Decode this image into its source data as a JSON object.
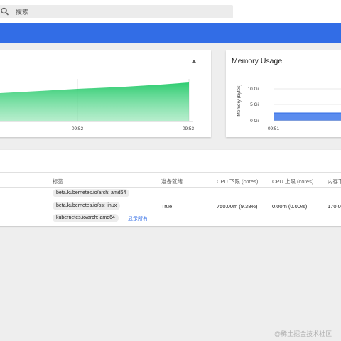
{
  "header": {
    "search": {
      "placeholder": "搜索"
    }
  },
  "colors": {
    "accent": "#326de6",
    "cpu_fill": "#2ecc71",
    "memory_fill": "#326de6"
  },
  "cpu_chart": {
    "x_ticks": [
      "09:52",
      "09:53"
    ]
  },
  "memory_chart": {
    "title": "Memory Usage",
    "y_label": "Memory (bytes)",
    "y_ticks": [
      "10 Gi",
      "5 Gi",
      "0 Gi"
    ],
    "x_ticks": [
      "09:51"
    ]
  },
  "table": {
    "columns": [
      "标签",
      "准备就绪",
      "CPU 下限 (cores)",
      "CPU 上限 (cores)",
      "内存下"
    ],
    "row": {
      "labels": [
        "beta.kubernetes.io/arch: amd64",
        "beta.kubernetes.io/os: linux",
        "kubernetes.io/arch: amd64"
      ],
      "show_all": "显示所有",
      "ready": "True",
      "cpu_requests": "750.00m (9.38%)",
      "cpu_limits": "0.00m (0.00%)",
      "memory_requests": "170.0"
    }
  },
  "watermark": "@稀土掘金技术社区"
}
